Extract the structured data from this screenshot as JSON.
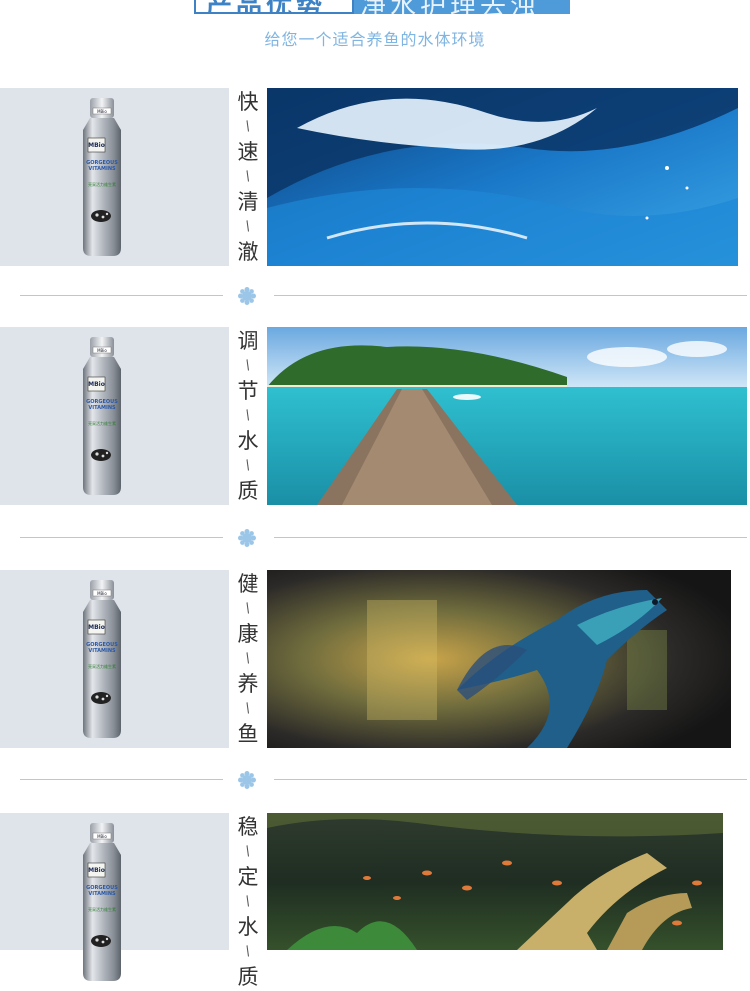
{
  "header": {
    "title_left": "产品优势",
    "title_right": "净水护理去浊",
    "subtitle": "给您一个适合养鱼的水体环境"
  },
  "product": {
    "brand": "MBio",
    "name_line1": "GORGEOUS",
    "name_line2": "VITAMINS",
    "cn_name": "亮采活力维生素",
    "cap_label": "MBio"
  },
  "sections": [
    {
      "chars": [
        "快",
        "速",
        "清",
        "澈"
      ],
      "photo": "ocean-wave"
    },
    {
      "chars": [
        "调",
        "节",
        "水",
        "质"
      ],
      "photo": "tropical-pier"
    },
    {
      "chars": [
        "健",
        "康",
        "养",
        "鱼"
      ],
      "photo": "betta-fish"
    },
    {
      "chars": [
        "稳",
        "定",
        "水",
        "质"
      ],
      "photo": "aquarium-tank"
    }
  ],
  "separator": "/",
  "colors": {
    "accent": "#4f9ad8",
    "accent_dark": "#3d82c4",
    "subtitle": "#7fb5e2",
    "divider": "#a9cde9",
    "product_panel": "#dfe3ea"
  }
}
